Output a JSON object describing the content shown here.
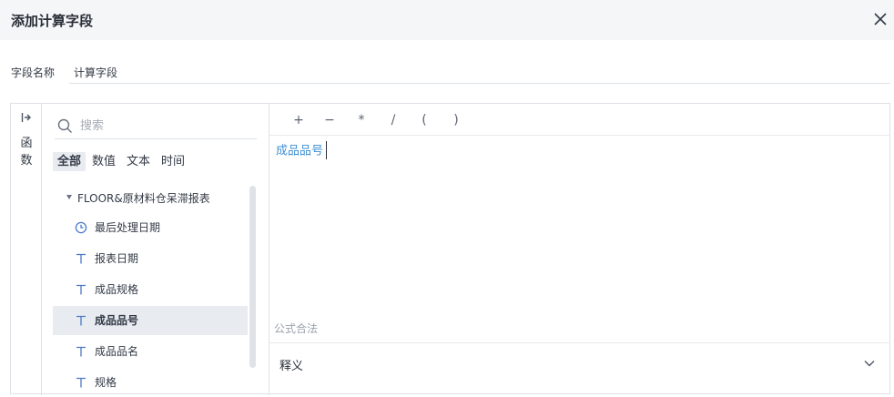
{
  "dialog": {
    "title": "添加计算字段"
  },
  "name_field": {
    "label": "字段名称",
    "value": "计算字段"
  },
  "func_tab": {
    "label": "函数"
  },
  "search": {
    "placeholder": "搜索"
  },
  "filters": [
    {
      "label": "全部",
      "active": true
    },
    {
      "label": "数值",
      "active": false
    },
    {
      "label": "文本",
      "active": false
    },
    {
      "label": "时间",
      "active": false
    }
  ],
  "tree": {
    "group_label": "FLOOR&原材料仓呆滞报表",
    "fields": [
      {
        "label": "最后处理日期",
        "icon": "clock-icon"
      },
      {
        "label": "报表日期",
        "icon": "text-type-icon"
      },
      {
        "label": "成品规格",
        "icon": "text-type-icon"
      },
      {
        "label": "成品品号",
        "icon": "text-type-icon",
        "selected": true
      },
      {
        "label": "成品品名",
        "icon": "text-type-icon"
      },
      {
        "label": "规格",
        "icon": "text-type-icon"
      }
    ]
  },
  "operators": [
    "+",
    "−",
    "*",
    "/",
    "(",
    ")"
  ],
  "formula": {
    "token": "成品品号"
  },
  "status": {
    "text": "公式合法"
  },
  "explain": {
    "label": "释义"
  },
  "colors": {
    "accent": "#3d8fd4",
    "selected_bg": "#e8ebf0",
    "header_bg": "#f5f6f8"
  }
}
